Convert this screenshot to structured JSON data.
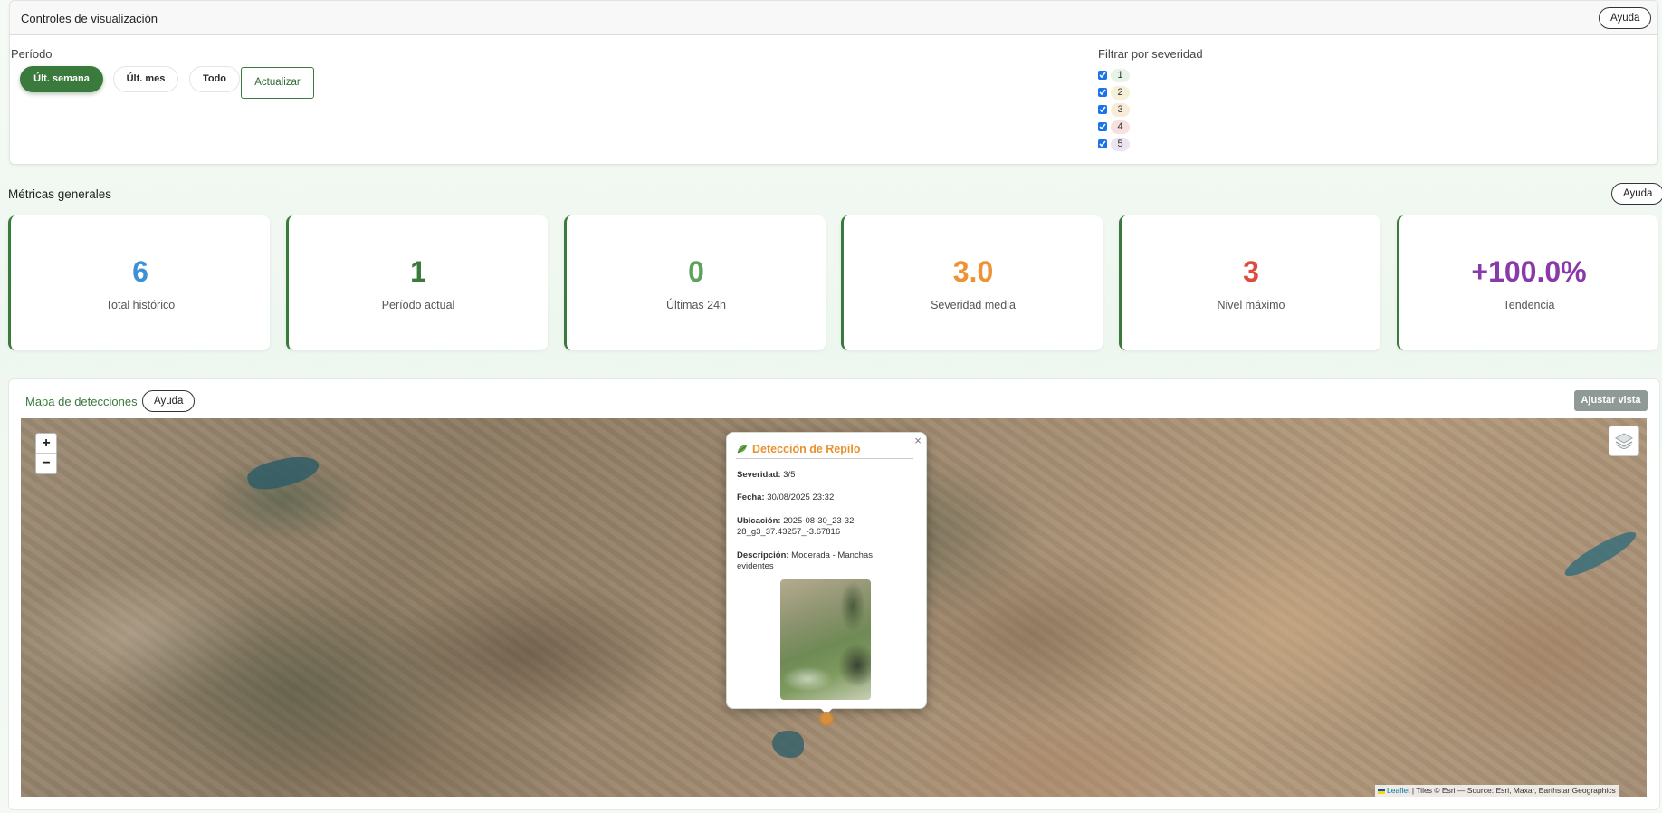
{
  "controls": {
    "title": "Controles de visualización",
    "help_label": "Ayuda",
    "period_label": "Período",
    "period_options": [
      "Últ. semana",
      "Últ. mes",
      "Todo"
    ],
    "period_active": "Últ. semana",
    "refresh_label": "Actualizar",
    "severity_filter_label": "Filtrar por severidad",
    "severity_levels": [
      {
        "label": "1",
        "checked": true,
        "color": "#e6f3e6"
      },
      {
        "label": "2",
        "checked": true,
        "color": "#f7f0d8"
      },
      {
        "label": "3",
        "checked": true,
        "color": "#f8ecd9"
      },
      {
        "label": "4",
        "checked": true,
        "color": "#f6e0e0"
      },
      {
        "label": "5",
        "checked": true,
        "color": "#ece3f3"
      }
    ]
  },
  "metrics": {
    "title": "Métricas generales",
    "help_label": "Ayuda",
    "cards": [
      {
        "value": "6",
        "label": "Total histórico",
        "color": "#3d8fd6"
      },
      {
        "value": "1",
        "label": "Período actual",
        "color": "#3b7a3d"
      },
      {
        "value": "0",
        "label": "Últimas 24h",
        "color": "#5aa35e"
      },
      {
        "value": "3.0",
        "label": "Severidad media",
        "color": "#ef9234"
      },
      {
        "value": "3",
        "label": "Nivel máximo",
        "color": "#e04b3f"
      },
      {
        "value": "+100.0%",
        "label": "Tendencia",
        "color": "#8a3aa8"
      }
    ]
  },
  "map": {
    "title": "Mapa de detecciones",
    "help_label": "Ayuda",
    "fit_view_label": "Ajustar vista",
    "zoom_in": "+",
    "zoom_out": "−",
    "attribution_leaflet": "Leaflet",
    "attribution_tiles": " | Tiles © Esri — Source: Esri, Maxar, Earthstar Geographics",
    "popup": {
      "close": "×",
      "title": "Detección de Repilo",
      "severity_label": "Severidad:",
      "severity_value": " 3/5",
      "date_label": "Fecha:",
      "date_value": " 30/08/2025 23:32",
      "location_label": "Ubicación:",
      "location_value": " 2025-08-30_23-32-28_g3_37.43257_-3.67816",
      "description_label": "Descripción:",
      "description_value": " Moderada - Manchas evidentes"
    }
  }
}
